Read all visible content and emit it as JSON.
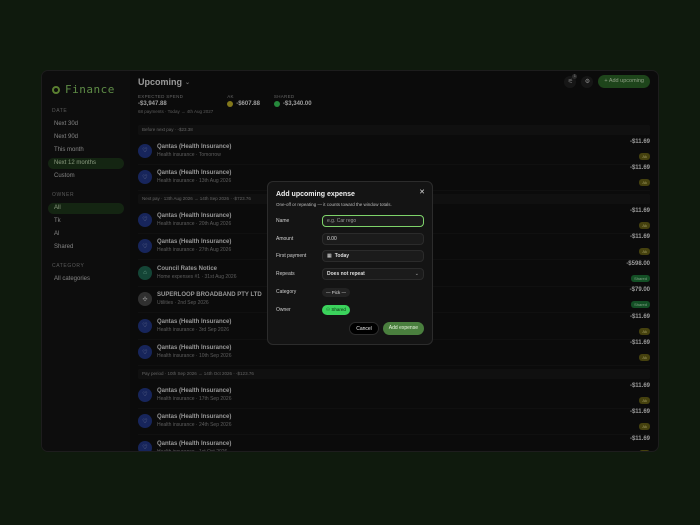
{
  "app": {
    "brand": "Finance"
  },
  "sidebar": {
    "date_title": "DATE",
    "date_items": [
      {
        "label": "Next 30d"
      },
      {
        "label": "Next 90d"
      },
      {
        "label": "This month"
      },
      {
        "label": "Next 12 months"
      },
      {
        "label": "Custom"
      }
    ],
    "owner_title": "OWNER",
    "owner_items": [
      {
        "label": "All"
      },
      {
        "label": "Tk"
      },
      {
        "label": "Al"
      },
      {
        "label": "Shared"
      }
    ],
    "category_title": "CATEGORY",
    "category_items": [
      {
        "label": "All categories"
      }
    ]
  },
  "header": {
    "title": "Upcoming",
    "expected_label": "EXPECTED SPEND",
    "expected_value": "-$3,947.88",
    "expected_sub": "68 payments · Today → 4th Aug 2027",
    "ak_label": "AK",
    "ak_value": "-$607.88",
    "shared_label": "SHARED",
    "shared_value": "-$3,340.00",
    "filter_count": "1",
    "add_label": "+ Add upcoming"
  },
  "groups": [
    {
      "label": "Before next pay · -$23.38",
      "rows": [
        {
          "name": "Qantas (Health Insurance)",
          "sub": "Health insurance · Tomorrow",
          "amount": "-$11.69",
          "owner": "Ak"
        },
        {
          "name": "Qantas (Health Insurance)",
          "sub": "Health insurance · 13th Aug 2026",
          "amount": "-$11.69",
          "owner": "Ak"
        }
      ]
    },
    {
      "label": "Next pay · 13th Aug 2026 → 14th Sep 2026 · -$723.76",
      "rows": [
        {
          "name": "Qantas (Health Insurance)",
          "sub": "Health insurance · 20th Aug 2026",
          "amount": "-$11.69",
          "owner": "Ak"
        },
        {
          "name": "Qantas (Health Insurance)",
          "sub": "Health insurance · 27th Aug 2026",
          "amount": "-$11.69",
          "owner": "Ak"
        },
        {
          "name": "Council Rates Notice",
          "sub": "Home expenses #1 · 31st Aug 2026",
          "amount": "-$598.00",
          "owner": "Shared"
        },
        {
          "name": "SUPERLOOP BROADBAND PTY LTD",
          "sub": "Utilities · 2nd Sep 2026",
          "amount": "-$79.00",
          "owner": "Shared"
        },
        {
          "name": "Qantas (Health Insurance)",
          "sub": "Health insurance · 3rd Sep 2026",
          "amount": "-$11.69",
          "owner": "Ak"
        },
        {
          "name": "Qantas (Health Insurance)",
          "sub": "Health insurance · 10th Sep 2026",
          "amount": "-$11.69",
          "owner": "Ak"
        }
      ]
    },
    {
      "label": "Pay period · 10th Sep 2026 → 14th Oct 2026 · -$123.76",
      "rows": [
        {
          "name": "Qantas (Health Insurance)",
          "sub": "Health insurance · 17th Sep 2026",
          "amount": "-$11.69",
          "owner": "Ak"
        },
        {
          "name": "Qantas (Health Insurance)",
          "sub": "Health insurance · 24th Sep 2026",
          "amount": "-$11.69",
          "owner": "Ak"
        },
        {
          "name": "Qantas (Health Insurance)",
          "sub": "Health insurance · 1st Oct 2026",
          "amount": "-$11.69",
          "owner": "Ak"
        }
      ]
    }
  ],
  "modal": {
    "title": "Add upcoming expense",
    "subtitle": "One-off or repeating — it counts toward the window totals.",
    "name_label": "Name",
    "name_placeholder": "e.g. Car rego",
    "amount_label": "Amount",
    "amount_value": "0.00",
    "first_payment_label": "First payment",
    "first_payment_value": "Today",
    "repeats_label": "Repeats",
    "repeats_value": "Does not repeat",
    "category_label": "Category",
    "category_value": "— Pick —",
    "owner_label": "Owner",
    "owner_value": "Shared",
    "cancel_label": "Cancel",
    "add_label": "Add expense"
  },
  "colors": {
    "accent": "#8fd46b",
    "ak_badge": "#6b6416",
    "shared_badge": "#1e7a3a"
  }
}
